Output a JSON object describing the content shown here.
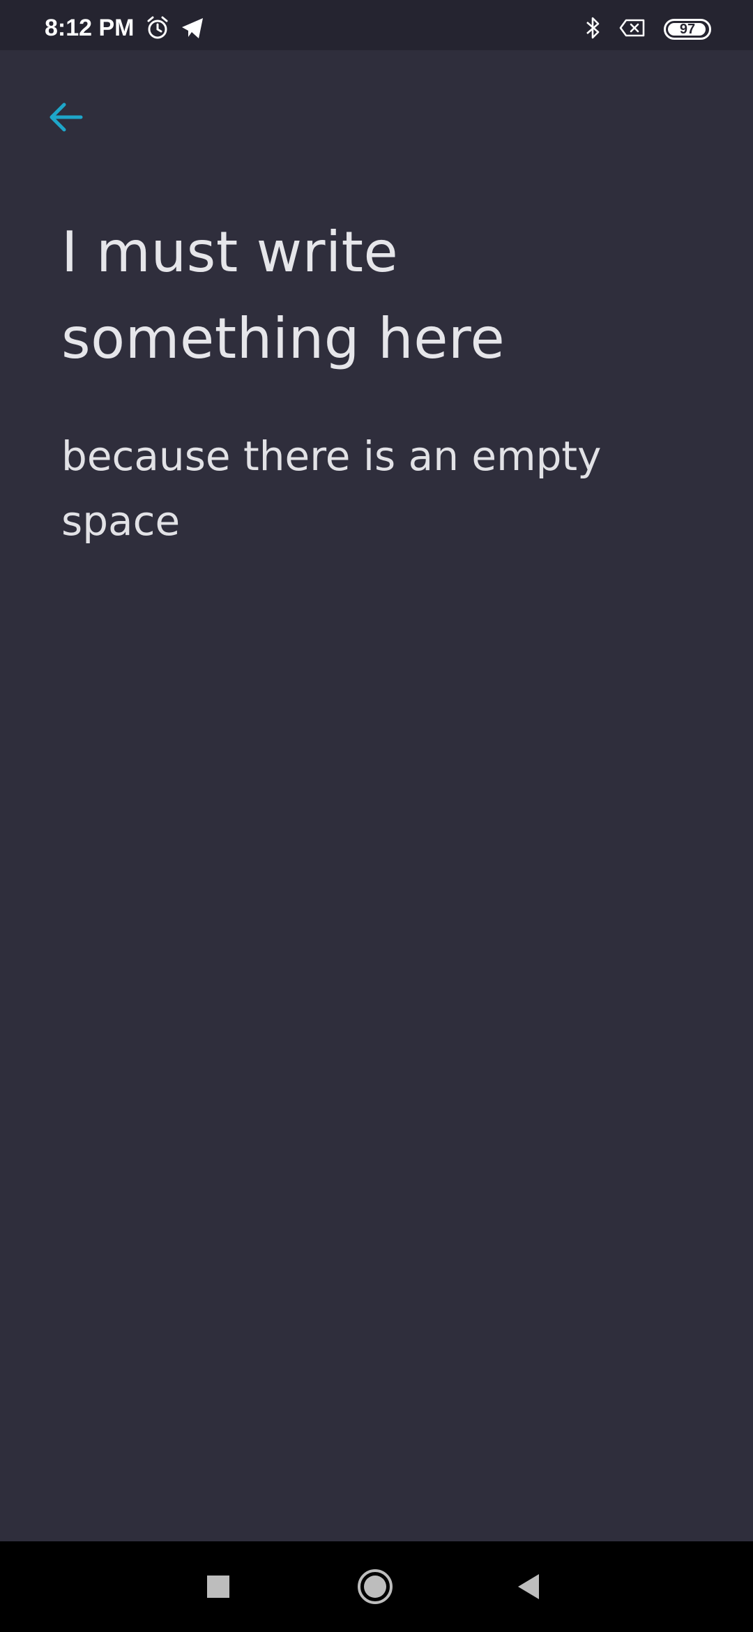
{
  "status_bar": {
    "time": "8:12 PM",
    "icons": [
      "alarm-icon",
      "telegram-icon",
      "bluetooth-icon",
      "sim-error-icon"
    ],
    "battery_level": 97,
    "battery_text": "97"
  },
  "header": {
    "back_icon": "arrow-left-icon",
    "accent_color": "#1ea6c9"
  },
  "note": {
    "title": "I must write something here",
    "body": "because there is an empty space"
  },
  "nav_bar": {
    "buttons": [
      "recents-icon",
      "home-icon",
      "back-triangle-icon"
    ]
  },
  "colors": {
    "background": "#2f2e3c",
    "status_bar": "#252430",
    "text": "#e6e6ea"
  }
}
